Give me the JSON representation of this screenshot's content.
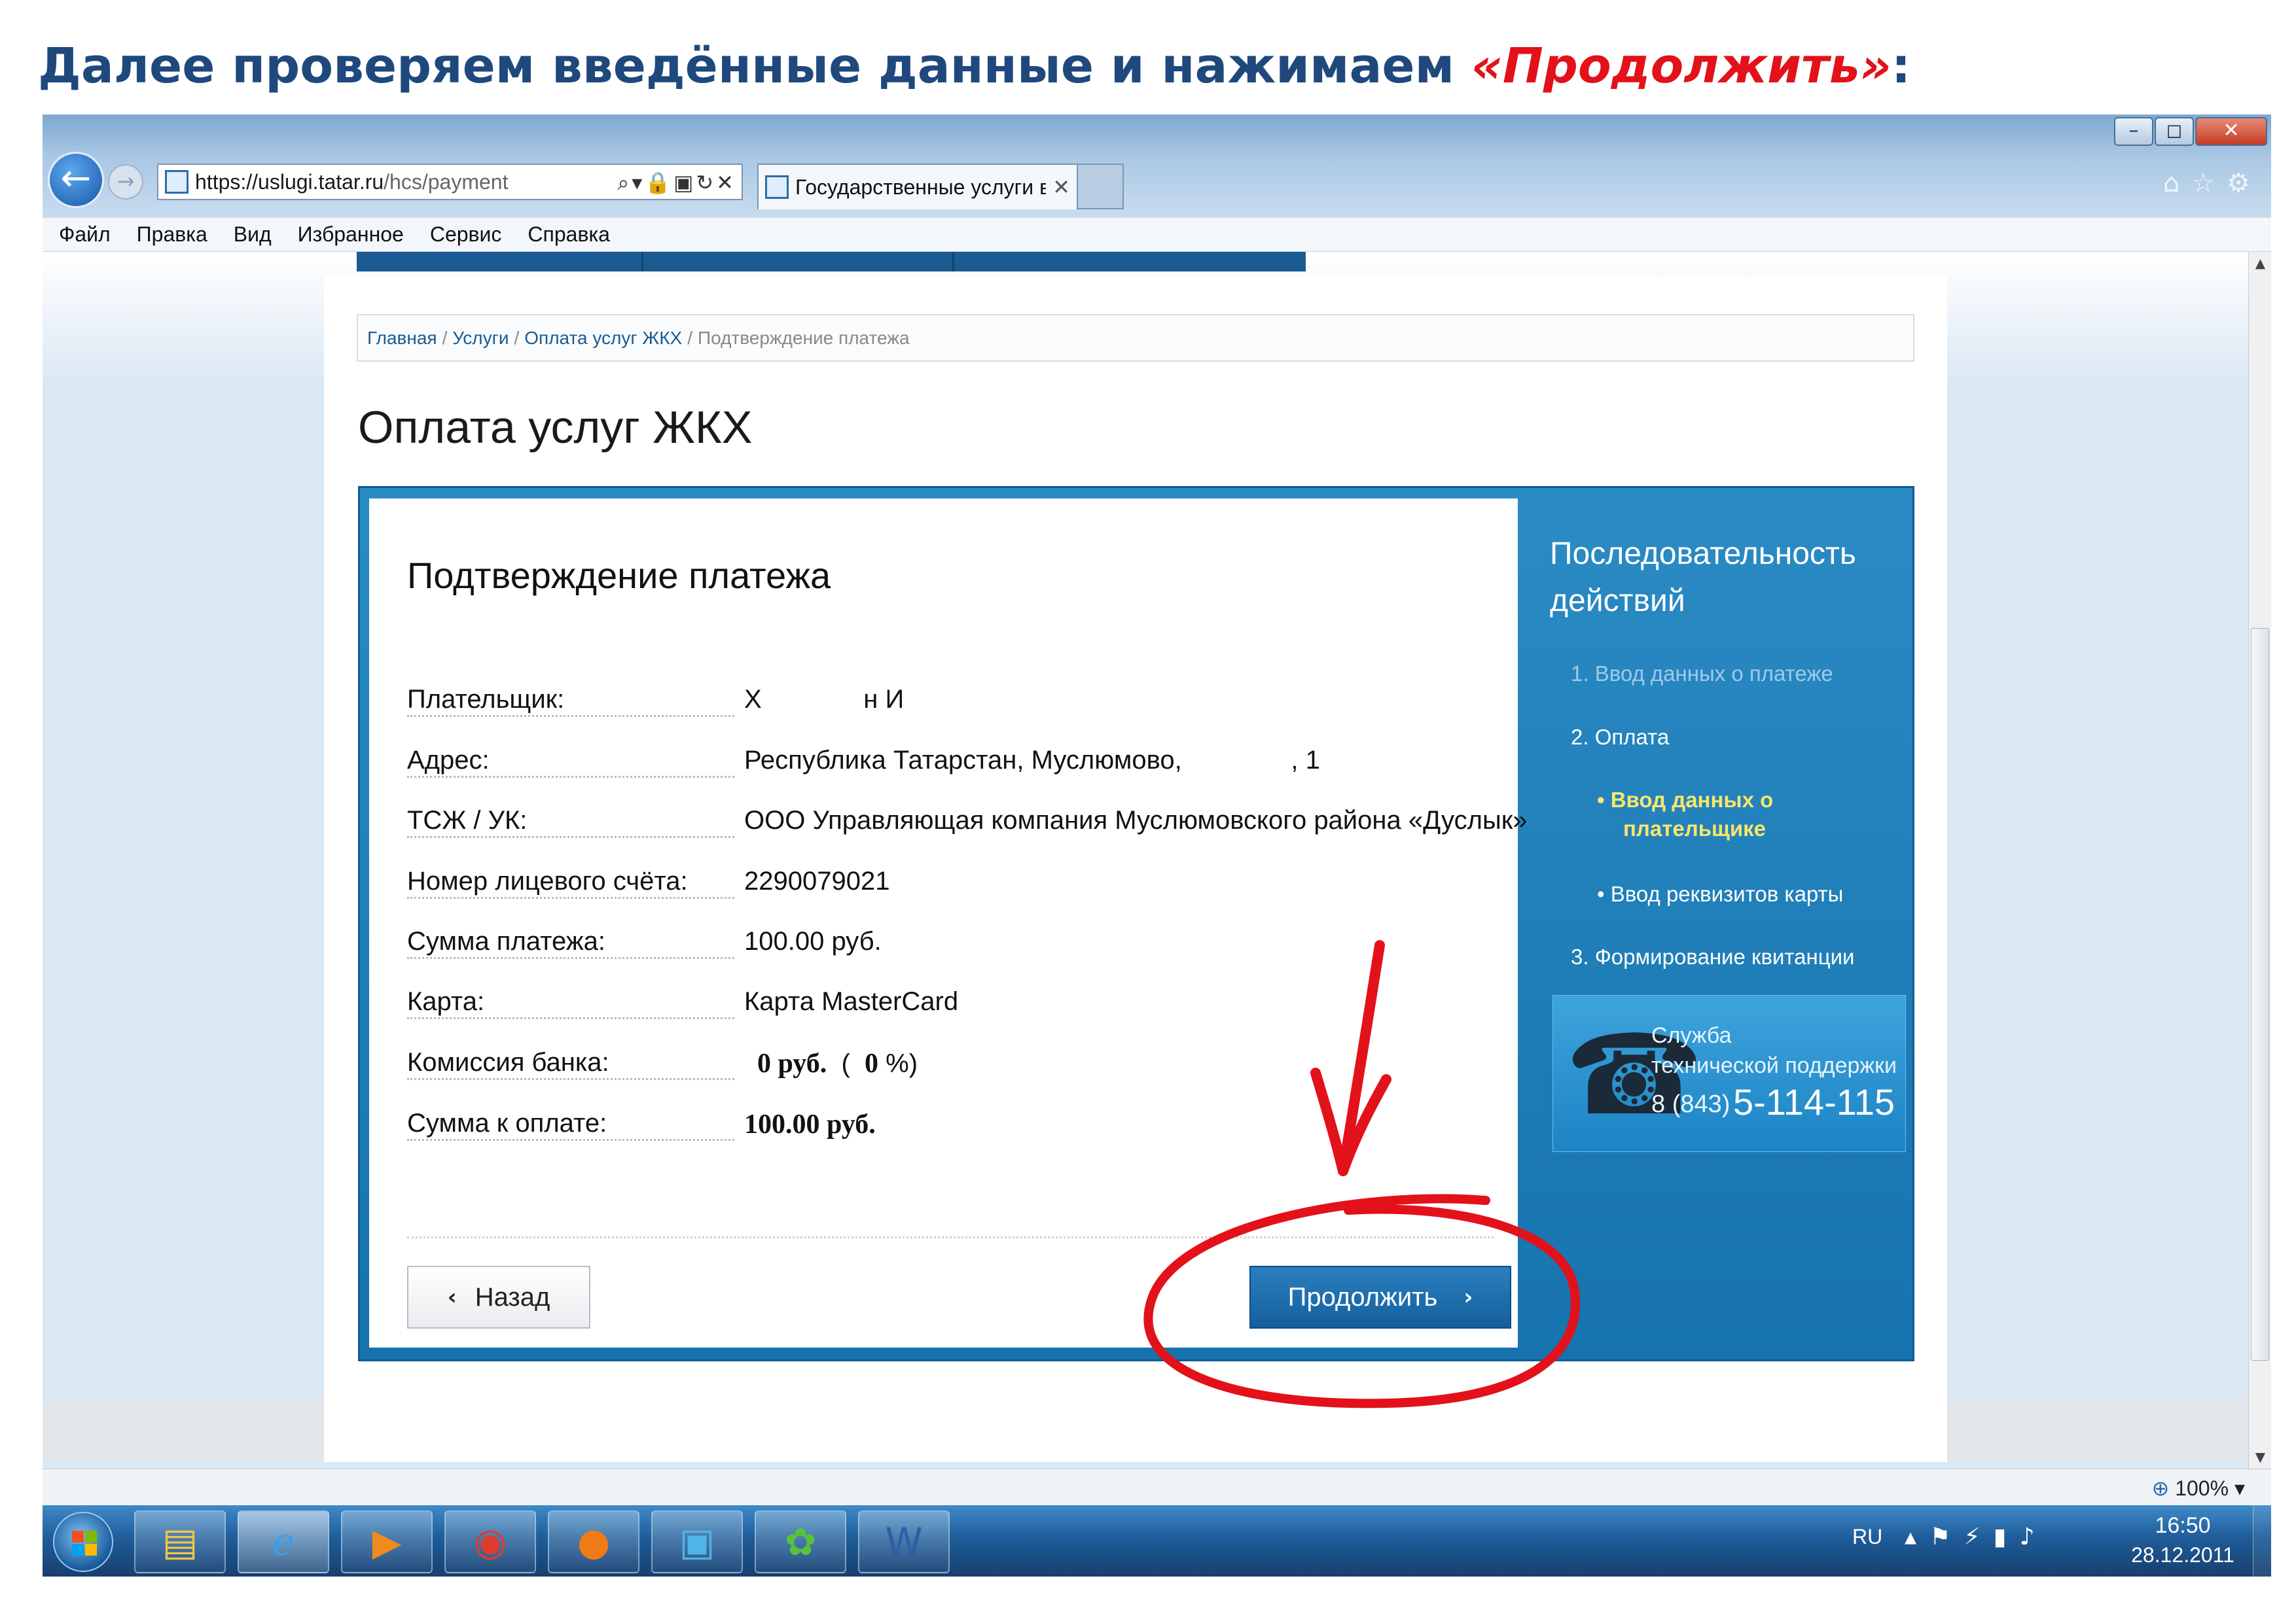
{
  "slide": {
    "title_main": "Далее проверяем введённые данные и нажимаем ",
    "title_accent": "«Продолжить»",
    "title_end": ":"
  },
  "browser": {
    "url_prefix": "https://",
    "url_host": "uslugi.tatar.ru",
    "url_path": "/hcs/payment",
    "tab_title": "Государственные услуги в...",
    "window_controls": {
      "minimize": "–",
      "maximize": "◻",
      "close": "✕"
    },
    "menu": [
      "Файл",
      "Правка",
      "Вид",
      "Избранное",
      "Сервис",
      "Справка"
    ],
    "zoom": "100%"
  },
  "page": {
    "breadcrumb": [
      "Главная",
      "Услуги",
      "Оплата услуг ЖКХ"
    ],
    "breadcrumb_current": "Подтверждение платежа",
    "title": "Оплата услуг ЖКХ",
    "form": {
      "heading": "Подтверждение платежа",
      "fields": [
        {
          "label": "Плательщик:",
          "value": "Х              н И"
        },
        {
          "label": "Адрес:",
          "value": "Республика Татарстан, Муслюмово,               , 1"
        },
        {
          "label": "ТСЖ / УК:",
          "value": "ООО Управляющая компания Муслюмовского района «Дуслык»"
        },
        {
          "label": "Номер лицевого счёта:",
          "value": "2290079021"
        },
        {
          "label": "Сумма платежа:",
          "value": "100.00 руб."
        },
        {
          "label": "Карта:",
          "value": "Карта MasterCard"
        },
        {
          "label": "Комиссия банка:",
          "value_bold_1": "0 руб.",
          "value_mid": "  (  ",
          "value_bold_2": "0",
          "value_end": " %)"
        },
        {
          "label": "Сумма к оплате:",
          "value_bold": "100.00 руб."
        }
      ],
      "back_label": "Назад",
      "continue_label": "Продолжить"
    },
    "steps": {
      "title_line1": "Последовательность",
      "title_line2": "действий",
      "items": [
        {
          "label": "1.  Ввод данных о платеже"
        },
        {
          "label": "2.  Оплата"
        },
        {
          "label_line1": "•  Ввод данных о",
          "label_line2": "плательщике"
        },
        {
          "label": "•  Ввод реквизитов карты"
        },
        {
          "label": "3.  Формирование квитанции"
        }
      ]
    },
    "support": {
      "line1": "Служба",
      "line2": "технической поддержки",
      "phone_code": "8 (843)",
      "phone_number": "5-114-115"
    }
  },
  "taskbar": {
    "apps": [
      "folder-icon",
      "internet-explorer-icon",
      "media-player-icon",
      "antivirus-icon",
      "firefox-icon",
      "remote-desktop-icon",
      "icq-icon",
      "word-icon"
    ],
    "language": "RU",
    "time": "16:50",
    "date": "28.12.2011"
  },
  "colors": {
    "title": "#1f497d",
    "accent": "#e3111a",
    "frame_blue": "#1673ad",
    "button_blue": "#145f9c",
    "step_highlight": "#f7e66b"
  }
}
